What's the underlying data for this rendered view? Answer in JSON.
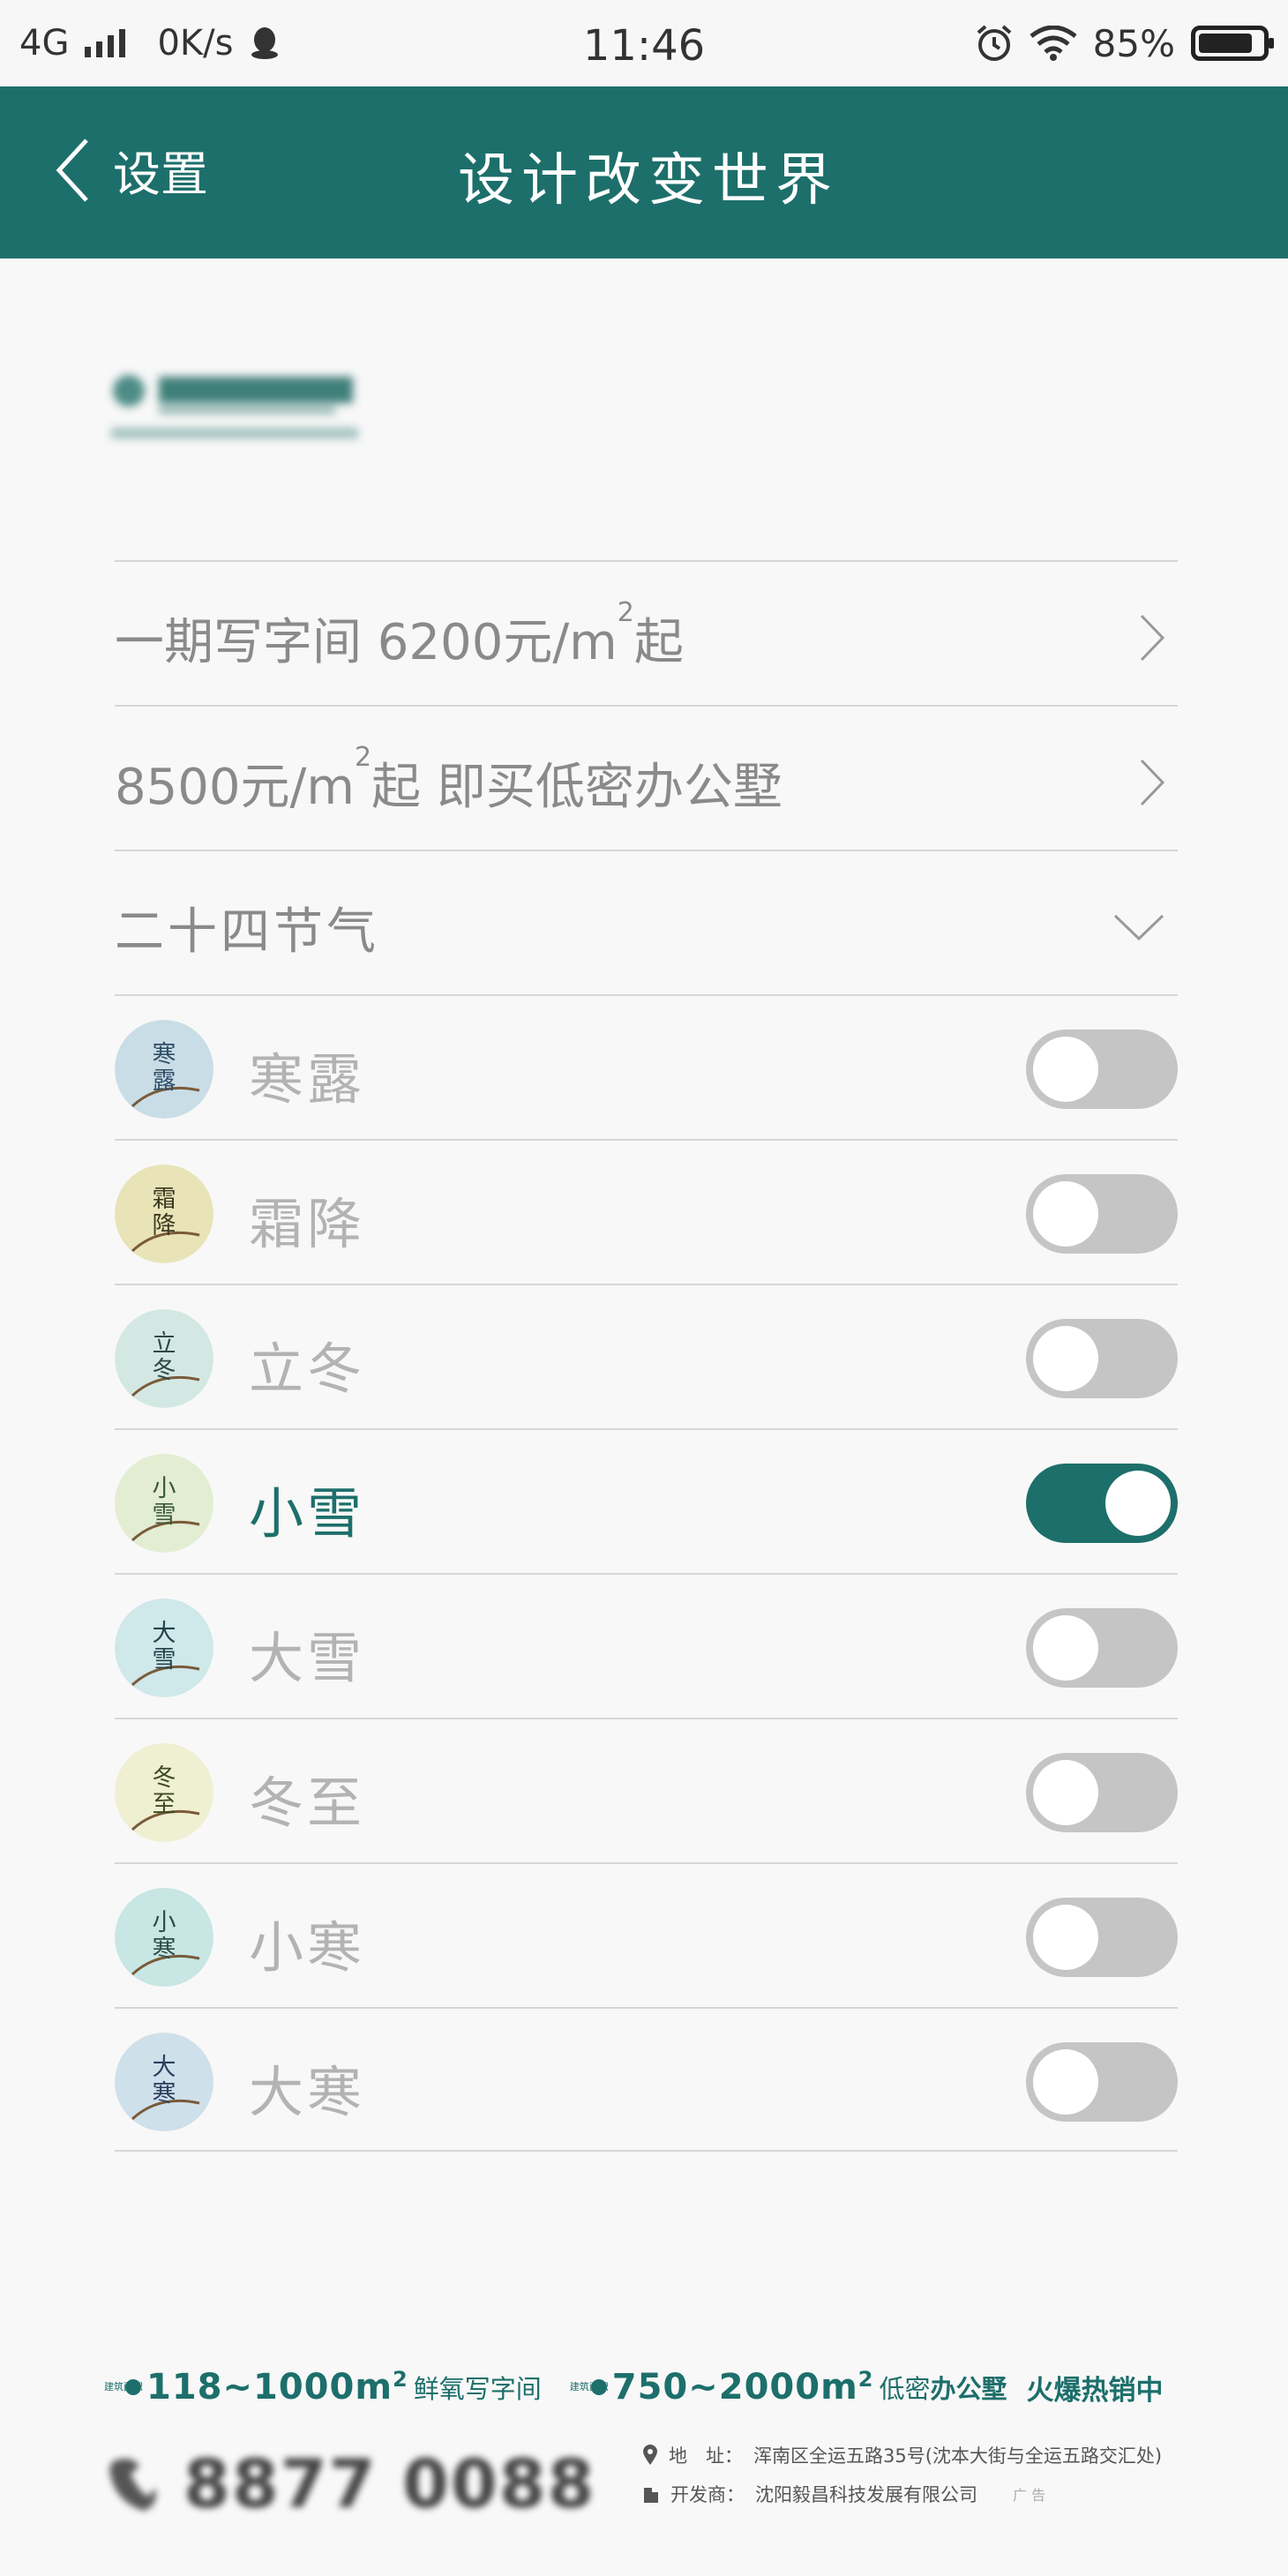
{
  "status_bar": {
    "network": "4G",
    "speed": "0K/s",
    "time": "11:46",
    "battery": "85%",
    "battery_level": 0.85
  },
  "nav": {
    "back_label": "设置",
    "title": "设计改变世界"
  },
  "menu": {
    "item1": {
      "prefix": "一期写字间 6200元/m",
      "sup": "2",
      "suffix": "起"
    },
    "item2": {
      "prefix": "8500元/m",
      "sup": "2",
      "suffix": "起 即买低密办公墅"
    },
    "section": "二十四节气"
  },
  "solar_terms": [
    {
      "label": "寒露",
      "glyph": "寒露",
      "enabled": false,
      "bg": "#c9dde6",
      "ink": "#2f4d66"
    },
    {
      "label": "霜降",
      "glyph": "霜降",
      "enabled": false,
      "bg": "#e8e4b8",
      "ink": "#3c3a22"
    },
    {
      "label": "立冬",
      "glyph": "立冬",
      "enabled": false,
      "bg": "#d4e8e3",
      "ink": "#2f4a44"
    },
    {
      "label": "小雪",
      "glyph": "小雪",
      "enabled": true,
      "bg": "#e2edd2",
      "ink": "#3b5a36"
    },
    {
      "label": "大雪",
      "glyph": "大雪",
      "enabled": false,
      "bg": "#cfe8ea",
      "ink": "#23424a"
    },
    {
      "label": "冬至",
      "glyph": "冬至",
      "enabled": false,
      "bg": "#eff0d2",
      "ink": "#3f4a22"
    },
    {
      "label": "小寒",
      "glyph": "小寒",
      "enabled": false,
      "bg": "#c7e6e4",
      "ink": "#2d4d49"
    },
    {
      "label": "大寒",
      "glyph": "大寒",
      "enabled": false,
      "bg": "#cee0ea",
      "ink": "#2b3f5c"
    }
  ],
  "footer": {
    "area_small_label": "建筑面积",
    "range1": "118~1000m",
    "range1_sup": "2",
    "desc1": "鲜氧写字间",
    "range2": "750~2000m",
    "range2_sup": "2",
    "desc2_pre": "低密",
    "desc2_bold": "办公墅",
    "hot": "火爆热销中",
    "phone": "8877 0088",
    "address_label": "地　址：",
    "address": "浑南区全运五路35号(沈本大街与全运五路交汇处)",
    "developer_label": "开发商：",
    "developer": "沈阳毅昌科技发展有限公司",
    "ad": "广 告"
  },
  "colors": {
    "accent": "#1d6f6b",
    "toggle_off": "#c5c5c5",
    "divider": "#d6d6d6"
  }
}
